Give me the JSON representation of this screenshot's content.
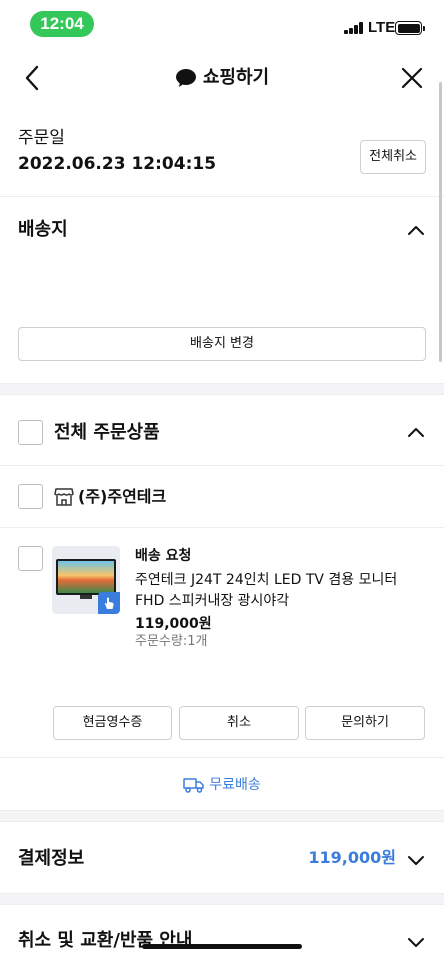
{
  "status_bar": {
    "time": "12:04",
    "network": "LTE"
  },
  "header": {
    "title": "쇼핑하기"
  },
  "order": {
    "date_label": "주문일",
    "date_value": "2022.06.23 12:04:15",
    "cancel_all": "전체취소"
  },
  "shipping": {
    "title": "배송지",
    "change_button": "배송지 변경"
  },
  "items": {
    "title": "전체 주문상품",
    "seller": "(주)주연테크",
    "product": {
      "status": "배송 요청",
      "name": "주연테크 J24T 24인치 LED TV 겸용 모니터 FHD 스피커내장 광시야각",
      "price": "119,000원",
      "quantity": "주문수량:1개"
    },
    "actions": {
      "receipt": "현금영수증",
      "cancel": "취소",
      "inquiry": "문의하기"
    },
    "shipping_type": "무료배송"
  },
  "payment": {
    "title": "결제정보",
    "amount": "119,000원"
  },
  "policy": {
    "title": "취소 및 교환/반품 안내"
  },
  "colors": {
    "accent": "#3b7ddd",
    "status_pill": "#34c759"
  }
}
